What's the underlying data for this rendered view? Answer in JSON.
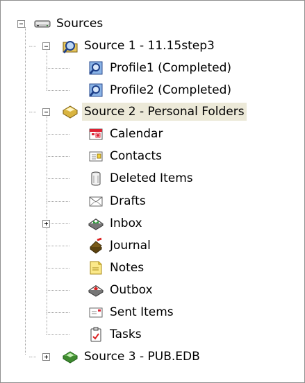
{
  "tree": {
    "root": {
      "label": "Sources",
      "icon": "drive-icon",
      "expanded": true
    },
    "source1": {
      "label": "Source 1 - 11.15step3",
      "icon": "search-folder-icon",
      "expanded": true,
      "children": [
        {
          "label": "Profile1 (Completed)",
          "icon": "profile-search-icon"
        },
        {
          "label": "Profile2 (Completed)",
          "icon": "profile-search-icon"
        }
      ]
    },
    "source2": {
      "label": "Source 2 - Personal Folders",
      "icon": "personal-folders-icon",
      "expanded": true,
      "selected": true,
      "children": [
        {
          "label": "Calendar",
          "icon": "calendar-icon"
        },
        {
          "label": "Contacts",
          "icon": "contacts-icon"
        },
        {
          "label": "Deleted Items",
          "icon": "trash-icon"
        },
        {
          "label": "Drafts",
          "icon": "envelope-icon"
        },
        {
          "label": "Inbox",
          "icon": "inbox-icon",
          "expandable": true
        },
        {
          "label": "Journal",
          "icon": "journal-icon"
        },
        {
          "label": "Notes",
          "icon": "notes-icon"
        },
        {
          "label": "Outbox",
          "icon": "outbox-icon"
        },
        {
          "label": "Sent Items",
          "icon": "sent-items-icon"
        },
        {
          "label": "Tasks",
          "icon": "tasks-icon"
        }
      ]
    },
    "source3": {
      "label": "Source 3 - PUB.EDB",
      "icon": "public-folders-icon",
      "expanded": false
    }
  }
}
